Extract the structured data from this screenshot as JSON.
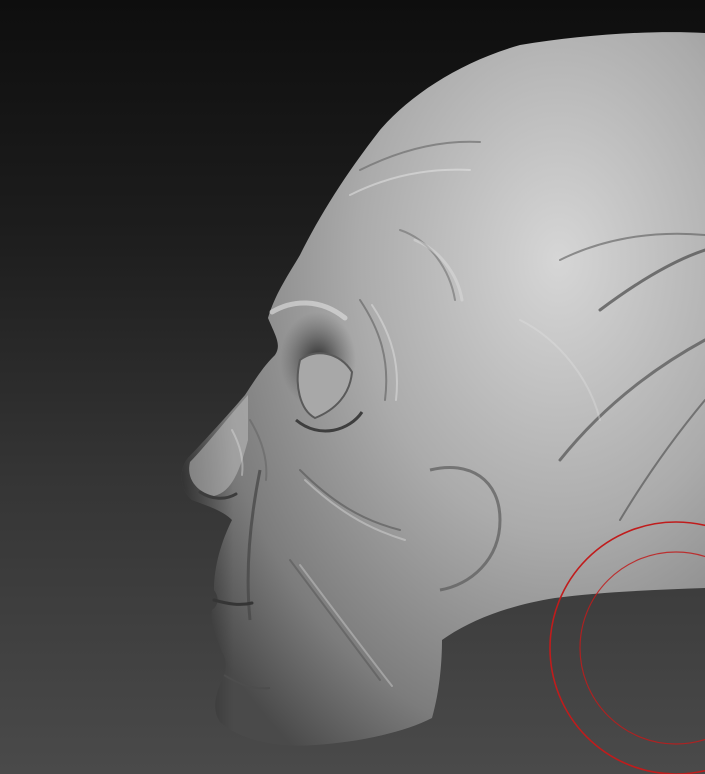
{
  "app": {
    "view": "sculpt-viewport",
    "model": "head-bust-profile-left"
  },
  "colors": {
    "background_top": "#0e0e0e",
    "background_bottom": "#4a4a4a",
    "clay": "#9c9c9c",
    "clay_highlight": "#d6d6d6",
    "clay_shadow": "#3d3d3d",
    "brush_cursor": "#c01c1c"
  },
  "icons": {
    "brush_cursor": "brush-cursor-icon"
  }
}
